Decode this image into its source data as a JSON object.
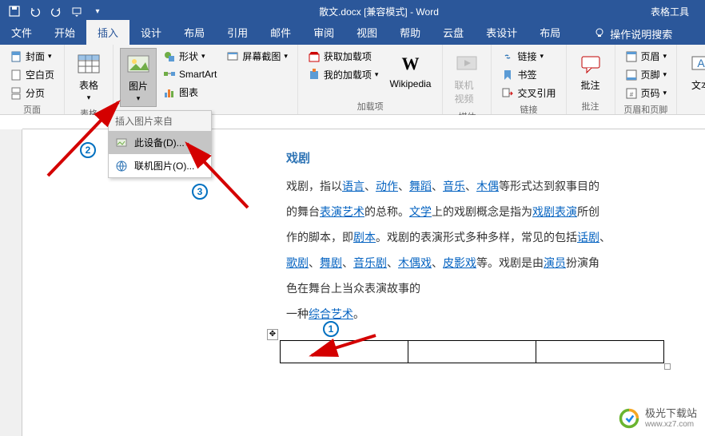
{
  "title": "散文.docx [兼容模式] - Word",
  "tableTools": "表格工具",
  "tabs": {
    "file": "文件",
    "home": "开始",
    "insert": "插入",
    "design": "设计",
    "layout": "布局",
    "references": "引用",
    "mailings": "邮件",
    "review": "审阅",
    "view": "视图",
    "help": "帮助",
    "cloud": "云盘",
    "tableDesign": "表设计",
    "tableLayout": "布局",
    "tellMe": "操作说明搜索"
  },
  "ribbon": {
    "pages": {
      "cover": "封面",
      "blank": "空白页",
      "break": "分页",
      "label": "页面"
    },
    "tables": {
      "table": "表格",
      "label": "表格"
    },
    "illustrations": {
      "pictures": "图片",
      "shapes": "形状",
      "smartart": "SmartArt",
      "chart": "图表",
      "screenshot": "屏幕截图"
    },
    "addins": {
      "get": "获取加载项",
      "my": "我的加载项",
      "wikipedia": "Wikipedia",
      "label": "加载项"
    },
    "media": {
      "video": "联机视频",
      "label": "媒体"
    },
    "links": {
      "link": "链接",
      "bookmark": "书签",
      "crossref": "交叉引用",
      "label": "链接"
    },
    "comments": {
      "comment": "批注",
      "label": "批注"
    },
    "header": {
      "header": "页眉",
      "footer": "页脚",
      "pagenum": "页码",
      "label": "页眉和页脚"
    },
    "text": {
      "textbox": "文本"
    }
  },
  "dropdown": {
    "header": "插入图片来自",
    "device": "此设备(D)...",
    "online": "联机图片(O)..."
  },
  "doc": {
    "title": "戏剧",
    "p1a": "戏剧，指以",
    "link_lang": "语言",
    "sep": "、",
    "link_action": "动作",
    "link_dance": "舞蹈",
    "link_music": "音乐",
    "link_puppet": "木偶",
    "p1b": "等形式达到叙事目的",
    "p2a": "的舞台",
    "link_perfart": "表演艺术",
    "p2b": "的总称。",
    "link_lit": "文学",
    "p2c": "上的戏剧概念是指为",
    "link_dramaperf": "戏剧表演",
    "p2d": "所创",
    "p3a": "作的脚本，即",
    "link_script": "剧本",
    "p3b": "。戏剧的表演形式多种多样，常见的包括",
    "link_spoken": "话剧",
    "p3c": "、",
    "link_opera": "歌剧",
    "link_dancedrama": "舞剧",
    "link_musical": "音乐剧",
    "link_puppetshow": "木偶戏",
    "link_shadow": "皮影戏",
    "p4a": "等。戏剧是由",
    "link_actor": "演员",
    "p4b": "扮演角",
    "p5": "色在舞台上当众表演故事的",
    "p6a": "一种",
    "link_compart": "综合艺术",
    "p6b": "。"
  },
  "markers": {
    "m1": "1",
    "m2": "2",
    "m3": "3"
  },
  "watermark": {
    "name": "极光下载站",
    "url": "www.xz7.com"
  }
}
